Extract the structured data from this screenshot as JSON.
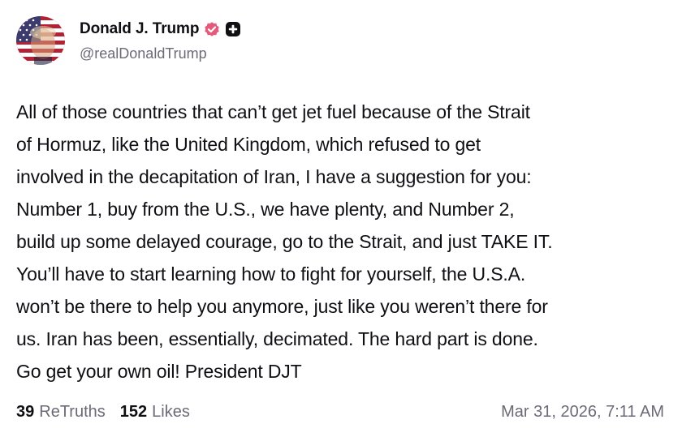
{
  "author": {
    "display_name": "Donald J. Trump",
    "handle": "@realDonaldTrump",
    "verified_icon": "verified-badge-icon",
    "plus_icon": "plus-badge-icon",
    "avatar_icon": "avatar-flag-portrait",
    "badge_color": "#e55a7a"
  },
  "post": {
    "text": "All of those countries that can’t get jet fuel because of the Strait\nof Hormuz, like the United Kingdom, which refused to get\ninvolved in the decapitation of Iran, I have a suggestion for you:\nNumber 1, buy from the U.S., we have plenty, and Number 2,\nbuild up some delayed courage, go to the Strait, and just TAKE IT.\nYou’ll have to start learning how to fight for yourself, the U.S.A.\nwon’t be there to help you anymore, just like you weren’t there for\nus. Iran has been, essentially, decimated. The hard part is done.\nGo get your own oil! President DJT"
  },
  "footer": {
    "retruths_count": "39",
    "retruths_label": "ReTruths",
    "likes_count": "152",
    "likes_label": "Likes",
    "timestamp": "Mar 31, 2026, 7:11 AM"
  }
}
